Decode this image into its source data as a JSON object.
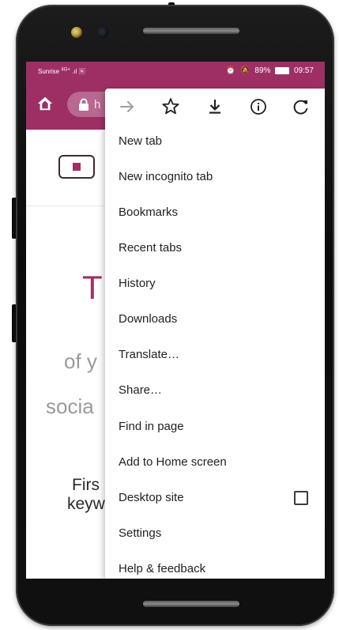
{
  "status_bar": {
    "carrier": "Sunrise",
    "network": "4G+",
    "battery_percent": "89%",
    "time": "09:57"
  },
  "toolbar": {
    "url_partial": "h"
  },
  "page": {
    "fragment_t": "T",
    "fragment_ofy": "of y",
    "fragment_socia": "socia",
    "fragment_first": "Firs",
    "fragment_keyw": "keyw"
  },
  "menu": {
    "icons": [
      "forward-icon",
      "star-icon",
      "download-icon",
      "info-icon",
      "refresh-icon"
    ],
    "items": [
      {
        "label": "New tab"
      },
      {
        "label": "New incognito tab"
      },
      {
        "label": "Bookmarks"
      },
      {
        "label": "Recent tabs"
      },
      {
        "label": "History"
      },
      {
        "label": "Downloads"
      },
      {
        "label": "Translate…"
      },
      {
        "label": "Share…"
      },
      {
        "label": "Find in page"
      },
      {
        "label": "Add to Home screen"
      },
      {
        "label": "Desktop site",
        "checked": false
      },
      {
        "label": "Settings"
      },
      {
        "label": "Help & feedback"
      }
    ]
  },
  "colors": {
    "brand": "#9e2f64",
    "menu_text": "#202124"
  }
}
